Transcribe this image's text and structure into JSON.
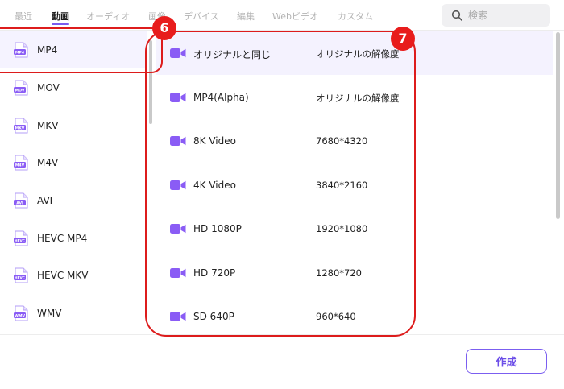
{
  "tabs": [
    {
      "label": "最近",
      "active": false
    },
    {
      "label": "動画",
      "active": true
    },
    {
      "label": "オーディオ",
      "active": false
    },
    {
      "label": "画像",
      "active": false
    },
    {
      "label": "デバイス",
      "active": false
    },
    {
      "label": "編集",
      "active": false
    },
    {
      "label": "Webビデオ",
      "active": false
    },
    {
      "label": "カスタム",
      "active": false
    }
  ],
  "search": {
    "placeholder": "検索",
    "icon": "search-icon"
  },
  "formats": [
    {
      "label": "MP4",
      "badge": "MP4",
      "selected": true
    },
    {
      "label": "MOV",
      "badge": "MOV",
      "selected": false
    },
    {
      "label": "MKV",
      "badge": "MKV",
      "selected": false
    },
    {
      "label": "M4V",
      "badge": "M4V",
      "selected": false
    },
    {
      "label": "AVI",
      "badge": "AVI",
      "selected": false
    },
    {
      "label": "HEVC MP4",
      "badge": "HEVC",
      "selected": false
    },
    {
      "label": "HEVC MKV",
      "badge": "HEVC",
      "selected": false
    },
    {
      "label": "WMV",
      "badge": "WMV",
      "selected": false
    }
  ],
  "presets": [
    {
      "name": "オリジナルと同じ",
      "resolution": "オリジナルの解像度",
      "selected": true
    },
    {
      "name": "MP4(Alpha)",
      "resolution": "オリジナルの解像度",
      "selected": false
    },
    {
      "name": "8K Video",
      "resolution": "7680*4320",
      "selected": false
    },
    {
      "name": "4K Video",
      "resolution": "3840*2160",
      "selected": false
    },
    {
      "name": "HD 1080P",
      "resolution": "1920*1080",
      "selected": false
    },
    {
      "name": "HD 720P",
      "resolution": "1280*720",
      "selected": false
    },
    {
      "name": "SD 640P",
      "resolution": "960*640",
      "selected": false
    }
  ],
  "footer": {
    "create_label": "作成"
  },
  "annotations": [
    {
      "number": "6"
    },
    {
      "number": "7"
    }
  ],
  "colors": {
    "accent": "#7b5ef0",
    "icon_purple": "#8a5cf5",
    "annotation_red": "#e81c1c",
    "selected_bg": "#f5f3ff"
  }
}
